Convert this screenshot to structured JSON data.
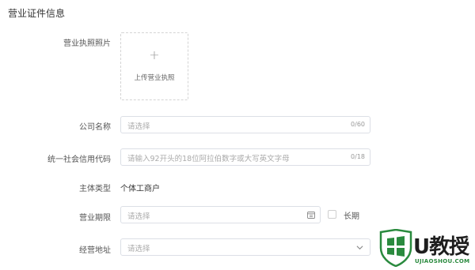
{
  "section": {
    "title": "营业证件信息"
  },
  "license": {
    "label": "营业执照照片",
    "upload_icon": "+",
    "upload_text": "上传营业执照"
  },
  "company": {
    "label": "公司名称",
    "placeholder": "请选择",
    "count": "0/60"
  },
  "credit_code": {
    "label": "统一社会信用代码",
    "placeholder": "请输入92开头的18位阿拉伯数字或大写英文字母",
    "count": "0/18"
  },
  "entity": {
    "label": "主体类型",
    "value": "个体工商户"
  },
  "period": {
    "label": "营业期限",
    "placeholder": "请选择",
    "icon": "calendar-icon",
    "long_term_label": "长期"
  },
  "address": {
    "label": "经营地址",
    "placeholder": "请选择",
    "icon": "chevron-down-icon"
  },
  "watermark": {
    "brand": "U教授",
    "url": "UJIAOSHOU.COM",
    "color": "#2a8a3e"
  }
}
